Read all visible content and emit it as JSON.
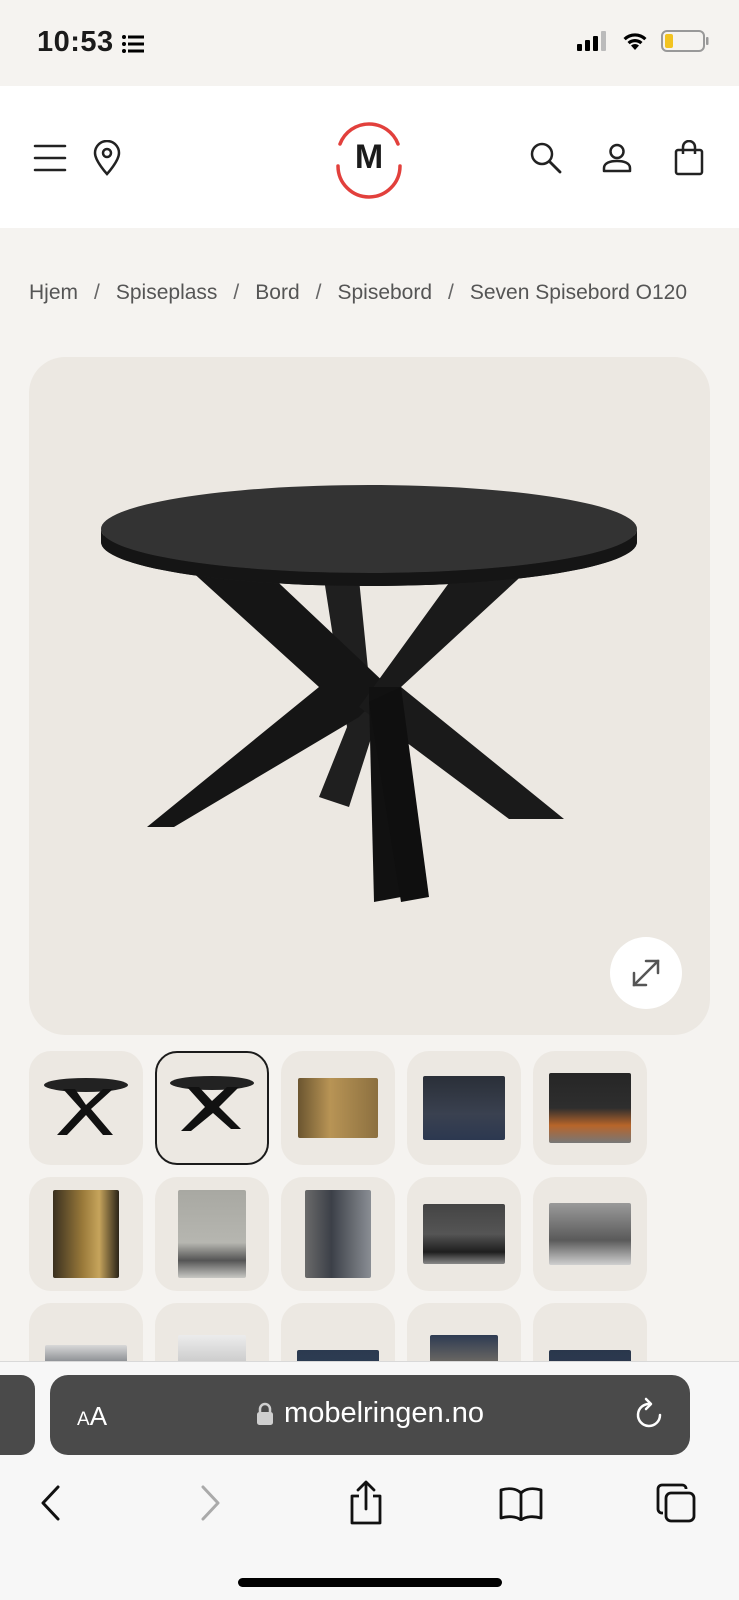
{
  "status": {
    "time": "10:53",
    "icons": [
      "list-icon",
      "signal-icon",
      "wifi-icon",
      "battery-icon"
    ]
  },
  "header": {
    "logo_letter": "M",
    "icons": [
      "menu-icon",
      "location-pin-icon",
      "search-icon",
      "user-icon",
      "shopping-bag-icon"
    ],
    "brand_color": "#e2403c"
  },
  "breadcrumb": [
    "Hjem",
    "Spiseplass",
    "Bord",
    "Spisebord",
    "Seven Spisebord O120"
  ],
  "gallery": {
    "main_image": "black round dining table with crossed legs",
    "expand_icon": "expand-icon",
    "selected_index": 1,
    "thumbnails": [
      "table-front",
      "table-angle",
      "room-yellow-chairs",
      "room-blue-chairs",
      "room-orange-chairs",
      "room-cabinet-gold",
      "room-grey-wall",
      "cabinet-display",
      "room-dark-table",
      "living-room",
      "room-shelves",
      "room-window",
      "room-navy-1",
      "room-navy-2",
      "room-navy-3"
    ]
  },
  "browser": {
    "text_size_label": "AA",
    "url": "mobelringen.no",
    "icons": [
      "lock-icon",
      "reload-icon",
      "back-icon",
      "forward-icon",
      "share-icon",
      "bookmarks-icon",
      "tabs-icon"
    ]
  }
}
